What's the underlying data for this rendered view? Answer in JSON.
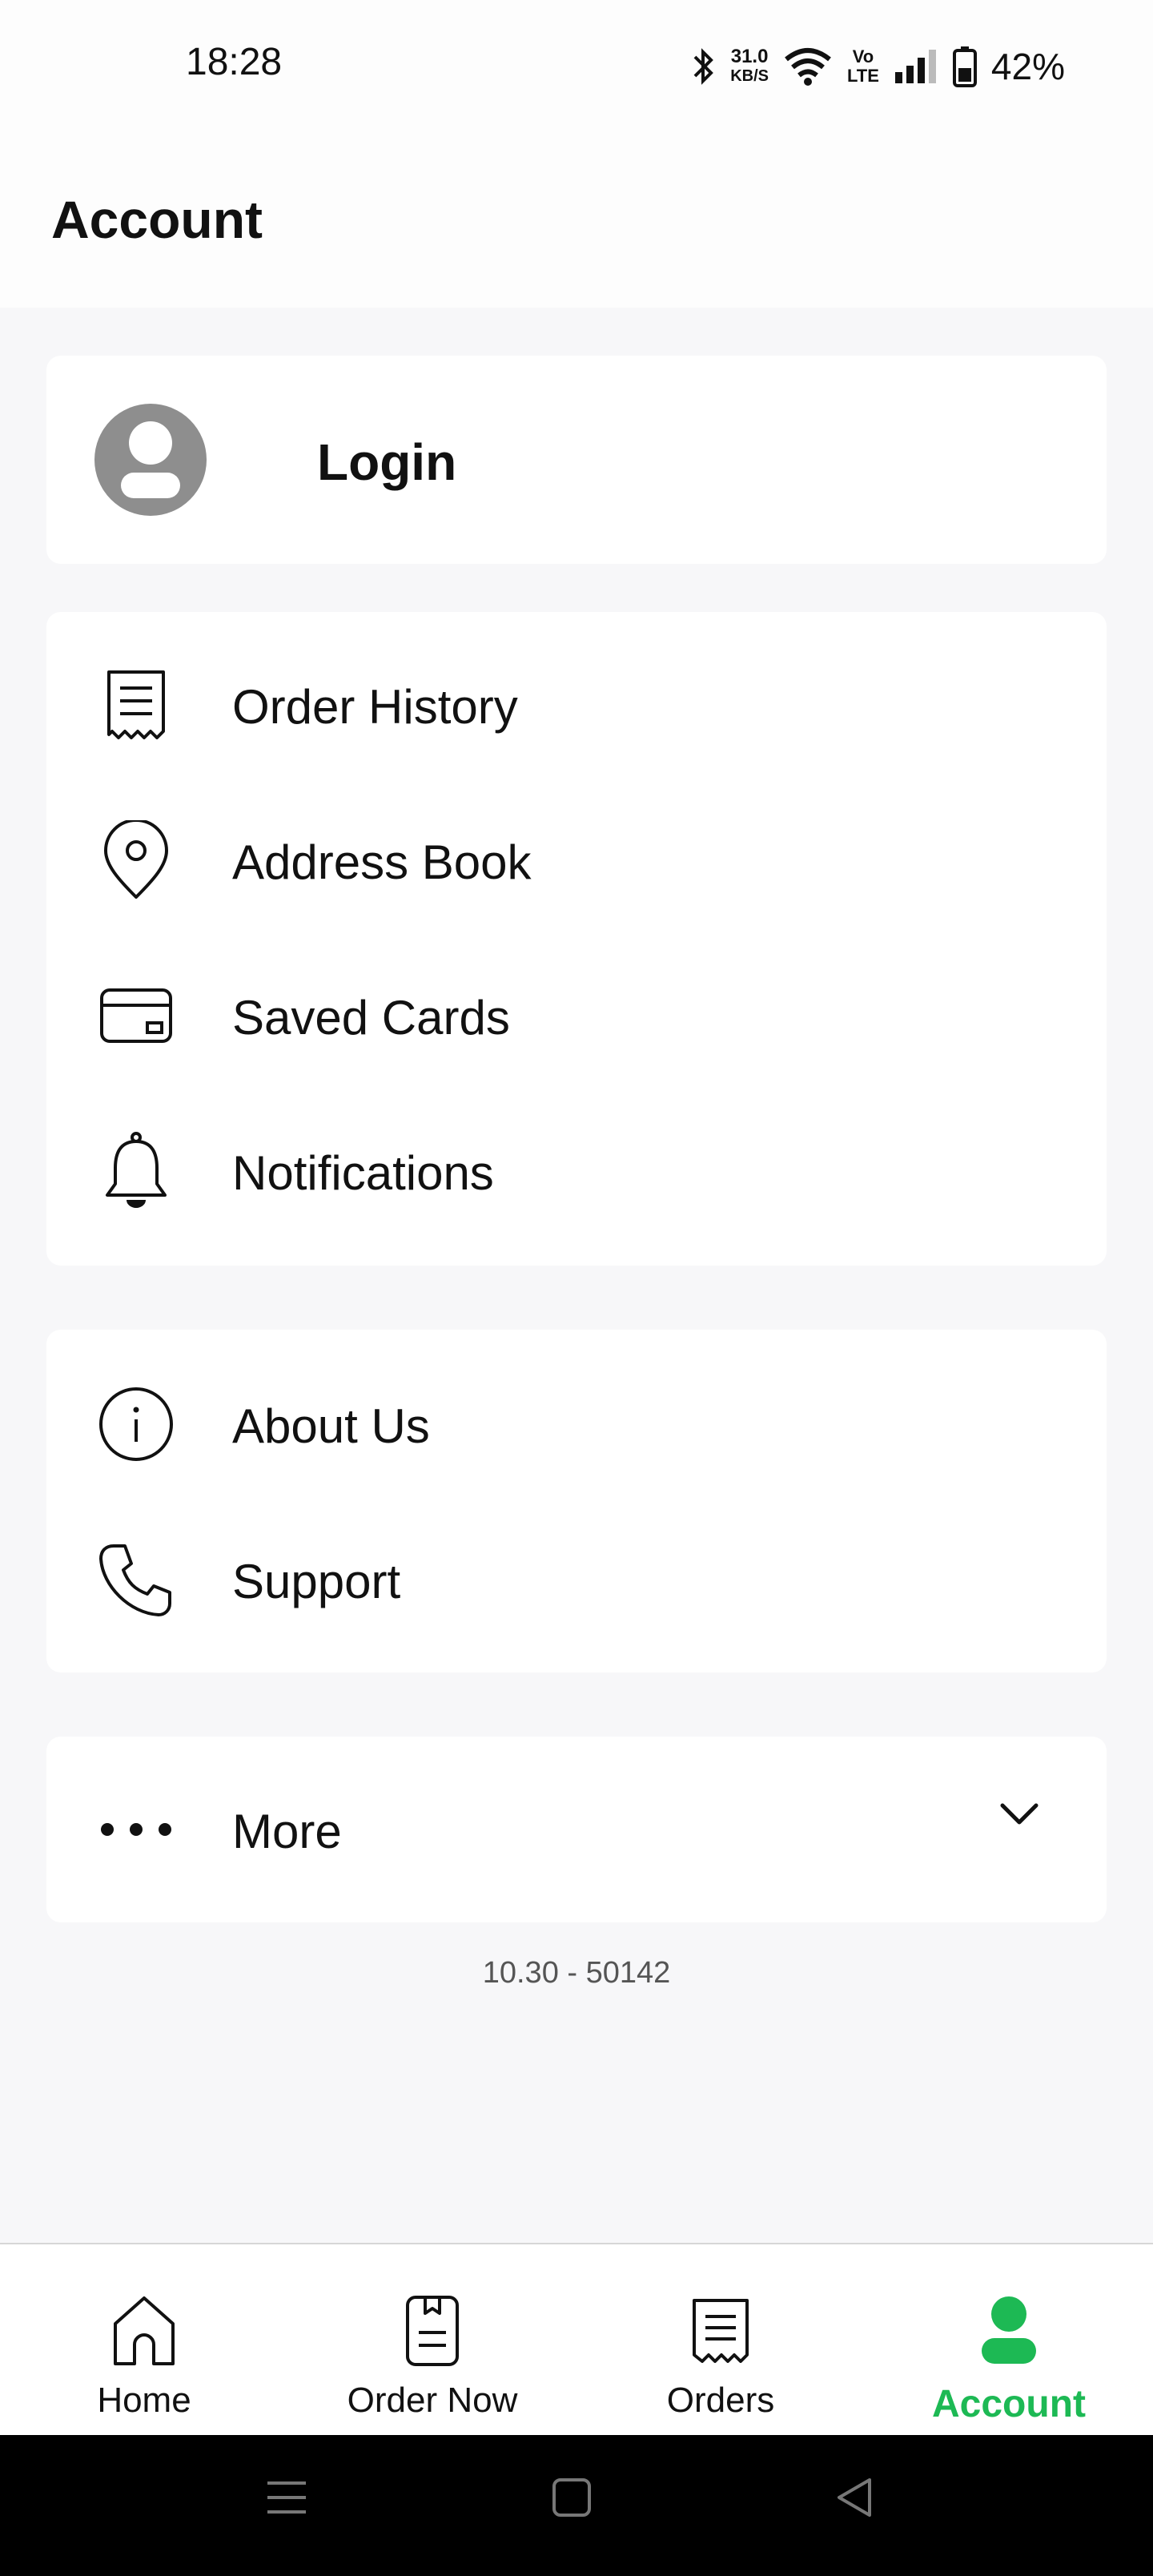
{
  "status_bar": {
    "time": "18:28",
    "net_speed_value": "31.0",
    "net_speed_unit": "KB/S",
    "volte_top": "Vo",
    "volte_bottom": "LTE",
    "battery_percent": "42%",
    "icons": [
      "bluetooth-icon",
      "wifi-icon",
      "volte-icon",
      "signal-icon",
      "battery-icon"
    ]
  },
  "header": {
    "title": "Account"
  },
  "login_card": {
    "label": "Login",
    "icon": "avatar-icon"
  },
  "menu_group_1": {
    "items": [
      {
        "label": "Order History",
        "icon": "receipt-icon"
      },
      {
        "label": "Address Book",
        "icon": "location-pin-icon"
      },
      {
        "label": "Saved Cards",
        "icon": "credit-card-icon"
      },
      {
        "label": "Notifications",
        "icon": "bell-icon"
      }
    ]
  },
  "menu_group_2": {
    "items": [
      {
        "label": "About Us",
        "icon": "info-icon"
      },
      {
        "label": "Support",
        "icon": "phone-icon"
      }
    ]
  },
  "more": {
    "label": "More",
    "icon": "dots-icon",
    "expand_icon": "chevron-down-icon"
  },
  "version": "10.30 - 50142",
  "bottom_nav": {
    "items": [
      {
        "label": "Home",
        "icon": "home-icon",
        "active": false
      },
      {
        "label": "Order Now",
        "icon": "order-now-icon",
        "active": false
      },
      {
        "label": "Orders",
        "icon": "orders-receipt-icon",
        "active": false
      },
      {
        "label": "Account",
        "icon": "account-icon",
        "active": true
      }
    ]
  },
  "colors": {
    "accent": "#1db954",
    "background": "#f7f7f9",
    "card": "#ffffff",
    "avatar": "#8e8e8e"
  },
  "system_nav": {
    "icons": [
      "menu-icon",
      "home-square-icon",
      "back-icon"
    ]
  }
}
